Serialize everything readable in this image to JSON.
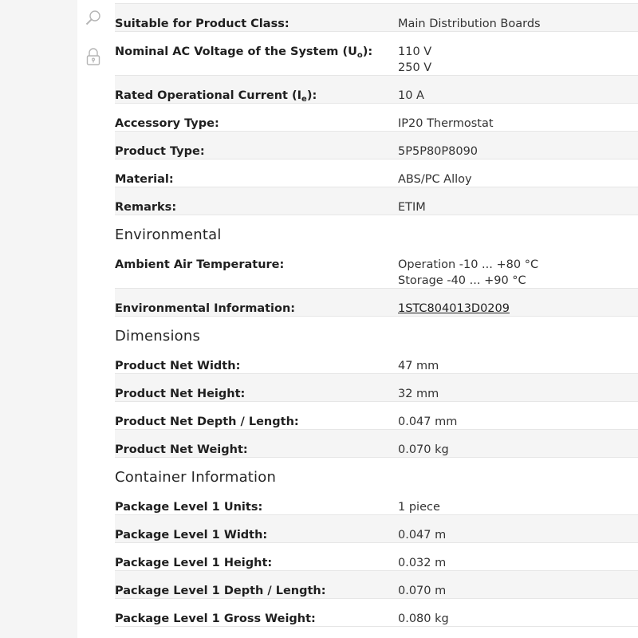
{
  "tools": {
    "search_icon": "search-icon",
    "lock_icon": "lock-icon"
  },
  "general_rows": [
    {
      "label": "Suitable for Product Class:",
      "values": [
        "Main Distribution Boards"
      ],
      "shaded": true,
      "h": 35
    },
    {
      "label_main": "Nominal AC Voltage of the System (U",
      "label_sub": "o",
      "label_end": "):",
      "values": [
        "110 V",
        "250 V"
      ],
      "shaded": false,
      "h": 55
    },
    {
      "label_main": "Rated Operational Current (I",
      "label_sub": "e",
      "label_end": "):",
      "values": [
        "10 A"
      ],
      "shaded": true,
      "h": 35
    },
    {
      "label": "Accessory Type:",
      "values": [
        "IP20 Thermostat"
      ],
      "shaded": false,
      "h": 35
    },
    {
      "label": "Product Type:",
      "values": [
        "5P5P80P8090"
      ],
      "shaded": true,
      "h": 35
    },
    {
      "label": "Material:",
      "values": [
        "ABS/PC Alloy"
      ],
      "shaded": false,
      "h": 35
    },
    {
      "label": "Remarks:",
      "values": [
        "ETIM"
      ],
      "shaded": true,
      "h": 35
    }
  ],
  "environmental": {
    "title": "Environmental",
    "rows": [
      {
        "label": "Ambient Air Temperature:",
        "values": [
          "Operation -10 ... +80 °C",
          "Storage -40 ... +90 °C"
        ],
        "shaded": false,
        "h": 55
      },
      {
        "label": "Environmental Information:",
        "values": [
          "1STC804013D0209"
        ],
        "link": true,
        "shaded": true,
        "h": 35
      }
    ]
  },
  "dimensions": {
    "title": "Dimensions",
    "rows": [
      {
        "label": "Product Net Width:",
        "values": [
          "47 mm"
        ],
        "shaded": false,
        "h": 35
      },
      {
        "label": "Product Net Height:",
        "values": [
          "32 mm"
        ],
        "shaded": true,
        "h": 35
      },
      {
        "label": "Product Net Depth / Length:",
        "values": [
          "0.047 mm"
        ],
        "shaded": false,
        "h": 35
      },
      {
        "label": "Product Net Weight:",
        "values": [
          "0.070 kg"
        ],
        "shaded": true,
        "h": 35
      }
    ]
  },
  "container": {
    "title": "Container Information",
    "rows": [
      {
        "label": "Package Level 1 Units:",
        "values": [
          "1 piece"
        ],
        "shaded": false,
        "h": 35
      },
      {
        "label": "Package Level 1 Width:",
        "values": [
          "0.047 m"
        ],
        "shaded": true,
        "h": 35
      },
      {
        "label": "Package Level 1 Height:",
        "values": [
          "0.032 m"
        ],
        "shaded": false,
        "h": 35
      },
      {
        "label": "Package Level 1 Depth / Length:",
        "values": [
          "0.070 m"
        ],
        "shaded": true,
        "h": 35
      },
      {
        "label": "Package Level 1 Gross Weight:",
        "values": [
          "0.080 kg"
        ],
        "shaded": false,
        "h": 35
      }
    ]
  }
}
